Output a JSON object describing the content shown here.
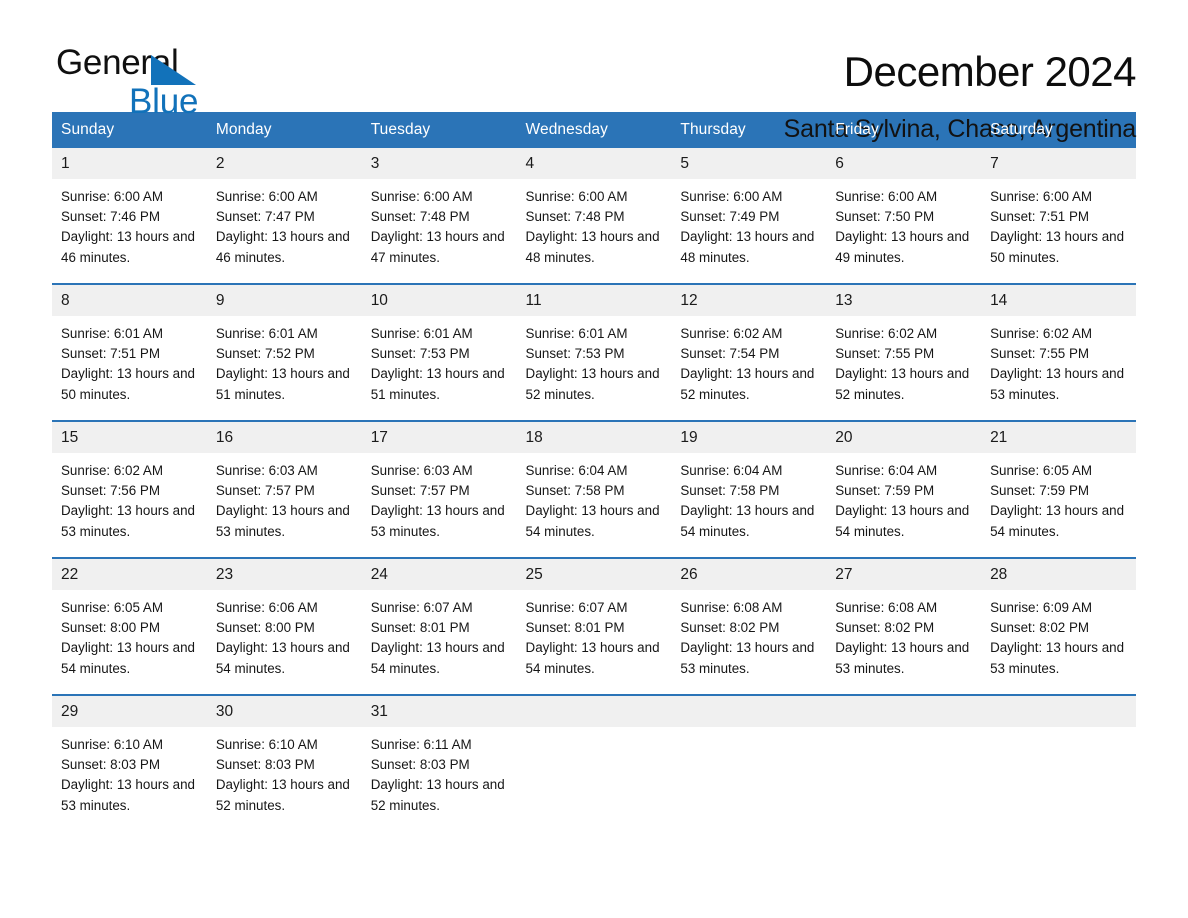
{
  "brand": {
    "name_part1": "General",
    "name_part2": "Blue",
    "accent_color": "#1272ba",
    "logo_icon": "triangle-flag-icon"
  },
  "header": {
    "title": "December 2024",
    "subtitle": "Santa Sylvina, Chaco, Argentina"
  },
  "calendar": {
    "header_bg": "#2b74b7",
    "daynum_bg": "#f0f0f0",
    "weekdays": [
      "Sunday",
      "Monday",
      "Tuesday",
      "Wednesday",
      "Thursday",
      "Friday",
      "Saturday"
    ],
    "weeks": [
      [
        {
          "day": "1",
          "sunrise": "Sunrise: 6:00 AM",
          "sunset": "Sunset: 7:46 PM",
          "daylight": "Daylight: 13 hours and 46 minutes."
        },
        {
          "day": "2",
          "sunrise": "Sunrise: 6:00 AM",
          "sunset": "Sunset: 7:47 PM",
          "daylight": "Daylight: 13 hours and 46 minutes."
        },
        {
          "day": "3",
          "sunrise": "Sunrise: 6:00 AM",
          "sunset": "Sunset: 7:48 PM",
          "daylight": "Daylight: 13 hours and 47 minutes."
        },
        {
          "day": "4",
          "sunrise": "Sunrise: 6:00 AM",
          "sunset": "Sunset: 7:48 PM",
          "daylight": "Daylight: 13 hours and 48 minutes."
        },
        {
          "day": "5",
          "sunrise": "Sunrise: 6:00 AM",
          "sunset": "Sunset: 7:49 PM",
          "daylight": "Daylight: 13 hours and 48 minutes."
        },
        {
          "day": "6",
          "sunrise": "Sunrise: 6:00 AM",
          "sunset": "Sunset: 7:50 PM",
          "daylight": "Daylight: 13 hours and 49 minutes."
        },
        {
          "day": "7",
          "sunrise": "Sunrise: 6:00 AM",
          "sunset": "Sunset: 7:51 PM",
          "daylight": "Daylight: 13 hours and 50 minutes."
        }
      ],
      [
        {
          "day": "8",
          "sunrise": "Sunrise: 6:01 AM",
          "sunset": "Sunset: 7:51 PM",
          "daylight": "Daylight: 13 hours and 50 minutes."
        },
        {
          "day": "9",
          "sunrise": "Sunrise: 6:01 AM",
          "sunset": "Sunset: 7:52 PM",
          "daylight": "Daylight: 13 hours and 51 minutes."
        },
        {
          "day": "10",
          "sunrise": "Sunrise: 6:01 AM",
          "sunset": "Sunset: 7:53 PM",
          "daylight": "Daylight: 13 hours and 51 minutes."
        },
        {
          "day": "11",
          "sunrise": "Sunrise: 6:01 AM",
          "sunset": "Sunset: 7:53 PM",
          "daylight": "Daylight: 13 hours and 52 minutes."
        },
        {
          "day": "12",
          "sunrise": "Sunrise: 6:02 AM",
          "sunset": "Sunset: 7:54 PM",
          "daylight": "Daylight: 13 hours and 52 minutes."
        },
        {
          "day": "13",
          "sunrise": "Sunrise: 6:02 AM",
          "sunset": "Sunset: 7:55 PM",
          "daylight": "Daylight: 13 hours and 52 minutes."
        },
        {
          "day": "14",
          "sunrise": "Sunrise: 6:02 AM",
          "sunset": "Sunset: 7:55 PM",
          "daylight": "Daylight: 13 hours and 53 minutes."
        }
      ],
      [
        {
          "day": "15",
          "sunrise": "Sunrise: 6:02 AM",
          "sunset": "Sunset: 7:56 PM",
          "daylight": "Daylight: 13 hours and 53 minutes."
        },
        {
          "day": "16",
          "sunrise": "Sunrise: 6:03 AM",
          "sunset": "Sunset: 7:57 PM",
          "daylight": "Daylight: 13 hours and 53 minutes."
        },
        {
          "day": "17",
          "sunrise": "Sunrise: 6:03 AM",
          "sunset": "Sunset: 7:57 PM",
          "daylight": "Daylight: 13 hours and 53 minutes."
        },
        {
          "day": "18",
          "sunrise": "Sunrise: 6:04 AM",
          "sunset": "Sunset: 7:58 PM",
          "daylight": "Daylight: 13 hours and 54 minutes."
        },
        {
          "day": "19",
          "sunrise": "Sunrise: 6:04 AM",
          "sunset": "Sunset: 7:58 PM",
          "daylight": "Daylight: 13 hours and 54 minutes."
        },
        {
          "day": "20",
          "sunrise": "Sunrise: 6:04 AM",
          "sunset": "Sunset: 7:59 PM",
          "daylight": "Daylight: 13 hours and 54 minutes."
        },
        {
          "day": "21",
          "sunrise": "Sunrise: 6:05 AM",
          "sunset": "Sunset: 7:59 PM",
          "daylight": "Daylight: 13 hours and 54 minutes."
        }
      ],
      [
        {
          "day": "22",
          "sunrise": "Sunrise: 6:05 AM",
          "sunset": "Sunset: 8:00 PM",
          "daylight": "Daylight: 13 hours and 54 minutes."
        },
        {
          "day": "23",
          "sunrise": "Sunrise: 6:06 AM",
          "sunset": "Sunset: 8:00 PM",
          "daylight": "Daylight: 13 hours and 54 minutes."
        },
        {
          "day": "24",
          "sunrise": "Sunrise: 6:07 AM",
          "sunset": "Sunset: 8:01 PM",
          "daylight": "Daylight: 13 hours and 54 minutes."
        },
        {
          "day": "25",
          "sunrise": "Sunrise: 6:07 AM",
          "sunset": "Sunset: 8:01 PM",
          "daylight": "Daylight: 13 hours and 54 minutes."
        },
        {
          "day": "26",
          "sunrise": "Sunrise: 6:08 AM",
          "sunset": "Sunset: 8:02 PM",
          "daylight": "Daylight: 13 hours and 53 minutes."
        },
        {
          "day": "27",
          "sunrise": "Sunrise: 6:08 AM",
          "sunset": "Sunset: 8:02 PM",
          "daylight": "Daylight: 13 hours and 53 minutes."
        },
        {
          "day": "28",
          "sunrise": "Sunrise: 6:09 AM",
          "sunset": "Sunset: 8:02 PM",
          "daylight": "Daylight: 13 hours and 53 minutes."
        }
      ],
      [
        {
          "day": "29",
          "sunrise": "Sunrise: 6:10 AM",
          "sunset": "Sunset: 8:03 PM",
          "daylight": "Daylight: 13 hours and 53 minutes."
        },
        {
          "day": "30",
          "sunrise": "Sunrise: 6:10 AM",
          "sunset": "Sunset: 8:03 PM",
          "daylight": "Daylight: 13 hours and 52 minutes."
        },
        {
          "day": "31",
          "sunrise": "Sunrise: 6:11 AM",
          "sunset": "Sunset: 8:03 PM",
          "daylight": "Daylight: 13 hours and 52 minutes."
        },
        {
          "day": "",
          "sunrise": "",
          "sunset": "",
          "daylight": ""
        },
        {
          "day": "",
          "sunrise": "",
          "sunset": "",
          "daylight": ""
        },
        {
          "day": "",
          "sunrise": "",
          "sunset": "",
          "daylight": ""
        },
        {
          "day": "",
          "sunrise": "",
          "sunset": "",
          "daylight": ""
        }
      ]
    ]
  }
}
